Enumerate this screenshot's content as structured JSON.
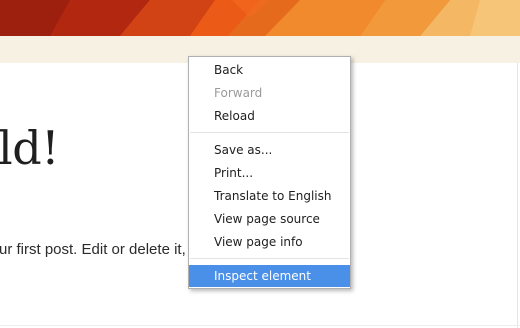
{
  "page": {
    "title_fragment": "ld!",
    "body_fragment": "ur first post. Edit or delete it,"
  },
  "colors": {
    "banner_red": "#b22710",
    "banner_orange": "#ec7c22",
    "banner_light": "#f4b763",
    "strip": "#f7f1e3",
    "menu_highlight": "#4a90e8"
  },
  "context_menu": {
    "groups": [
      [
        {
          "label": "Back",
          "enabled": true
        },
        {
          "label": "Forward",
          "enabled": false
        },
        {
          "label": "Reload",
          "enabled": true
        }
      ],
      [
        {
          "label": "Save as...",
          "enabled": true
        },
        {
          "label": "Print...",
          "enabled": true
        },
        {
          "label": "Translate to English",
          "enabled": true
        },
        {
          "label": "View page source",
          "enabled": true
        },
        {
          "label": "View page info",
          "enabled": true
        }
      ],
      [
        {
          "label": "Inspect element",
          "enabled": true,
          "highlighted": true
        }
      ]
    ]
  }
}
